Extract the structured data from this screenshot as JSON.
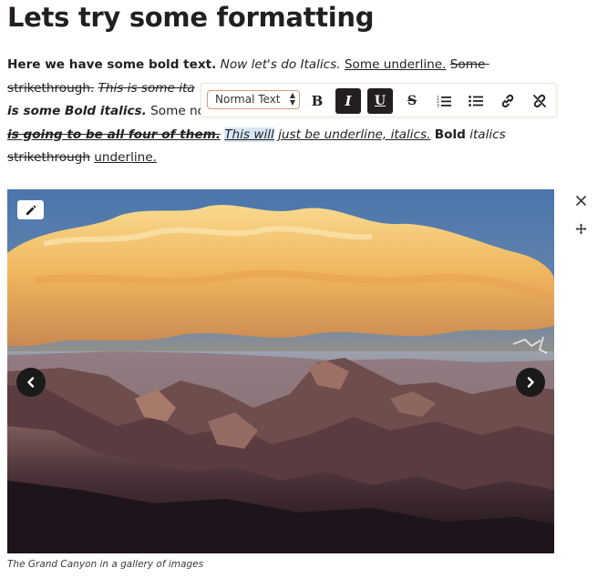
{
  "title": "Lets try some formatting",
  "paragraph": {
    "runs": [
      "Here we have some bold text.",
      "Now let's do Italics.",
      "Some underline.",
      "Some strikethrough.",
      "This is some ita",
      "is some Bold italics.",
      "Some no",
      "is going to be all four of them.",
      "This will",
      "just be underline, italics.",
      "Bold",
      "italics",
      "strikethrough",
      "under",
      "line."
    ]
  },
  "toolbar": {
    "block_format": "Normal Text",
    "buttons": [
      {
        "name": "bold",
        "glyph": "B",
        "active": false
      },
      {
        "name": "italic",
        "glyph": "I",
        "active": true
      },
      {
        "name": "underline",
        "glyph": "U",
        "active": true
      },
      {
        "name": "strikethrough",
        "glyph": "S",
        "active": false
      },
      {
        "name": "ordered-list",
        "active": false
      },
      {
        "name": "bullet-list",
        "active": false
      },
      {
        "name": "link",
        "active": false
      },
      {
        "name": "unlink",
        "active": false
      }
    ]
  },
  "gallery": {
    "caption": "The Grand Canyon in a gallery of images",
    "image_subject": "Grand Canyon at sunset"
  },
  "colors": {
    "text": "#231f20",
    "toolbar_active": "#231f20",
    "select_border": "#d79b7b",
    "selection_highlight": "#d7e6f5",
    "sky": "#4a76ad",
    "cloud": "#f2c46c"
  }
}
